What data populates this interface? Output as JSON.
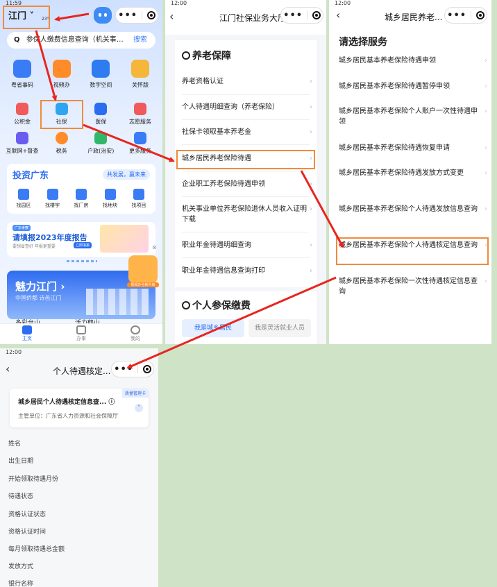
{
  "panel1": {
    "city": "江门",
    "city_temp": "23°",
    "search_text": "参保人缴费信息查询（机关事…",
    "search_button": "搜索",
    "top_row": [
      "粤省事码",
      "视频办",
      "数字空间",
      "关怀版"
    ],
    "second_row": [
      "公积金",
      "社保",
      "医保",
      "志愿服务"
    ],
    "third_row": [
      "互联网+督查",
      "税务",
      "户政(治安)",
      "更多服务"
    ],
    "invest_title": "投资广东",
    "invest_slogan": "共发展，赢未来",
    "invest_items": [
      "找园区",
      "找楼宇",
      "找厂房",
      "找地块",
      "找项目"
    ],
    "banner_tag": "广东考察",
    "banner_title": "请填报2023年度报告",
    "banner_sub": "要想省督好 年报更重要",
    "banner_btn": "立即填报",
    "float_label": "视频办全新升级",
    "charm_title": "魅力江门",
    "charm_sub": "中国侨都 诗邑江门",
    "cards": [
      "多彩台山",
      "活力鹤山"
    ],
    "tabbar": [
      "主页",
      "办事",
      "我的"
    ]
  },
  "panel2": {
    "title": "江门社保业务大厅",
    "section1": "养老保障",
    "items": [
      "养老资格认证",
      "个人待遇明细查询（养老保险）",
      "社保卡领取基本养老金",
      "城乡居民养老保险待遇",
      "企业职工养老保险待遇申领",
      "机关事业单位养老保险退休人员收入证明下载",
      "职业年金待遇明细查询",
      "职业年金待遇信息查询打印"
    ],
    "section2": "个人参保缴费",
    "tab_active": "我是城乡居民",
    "tab_other": "我是灵活就业人员"
  },
  "panel3": {
    "title": "城乡居民养老...",
    "heading": "请选择服务",
    "items": [
      "城乡居民基本养老保险待遇申领",
      "城乡居民基本养老保险待遇暂停申领",
      "城乡居民基本养老保险个人账户一次性待遇申领",
      "城乡居民基本养老保险待遇恢复申请",
      "城乡居民基本养老保险待遇发放方式变更",
      "城乡居民基本养老保险个人待遇发放信息查询",
      "城乡居民基本养老保险个人待遇核定信息查询",
      "城乡居民基本养老保险一次性待遇核定信息查询"
    ]
  },
  "panel4": {
    "status_time": "12:00",
    "title": "个人待遇核定...",
    "card_title": "城乡居民个人待遇核定信息查...",
    "card_badge": "质量管理卡",
    "card_org": "主管单位：广东省人力资源和社会保障厅",
    "fields": [
      "姓名",
      "出生日期",
      "开始领取待遇月份",
      "待遇状态",
      "资格认证状态",
      "资格认证时间",
      "每月领取待遇总金额",
      "发放方式",
      "银行名称"
    ]
  },
  "colors": {
    "accent": "#2b6cf0",
    "highlight": "#f08a3c",
    "arrow": "#e8251f"
  }
}
